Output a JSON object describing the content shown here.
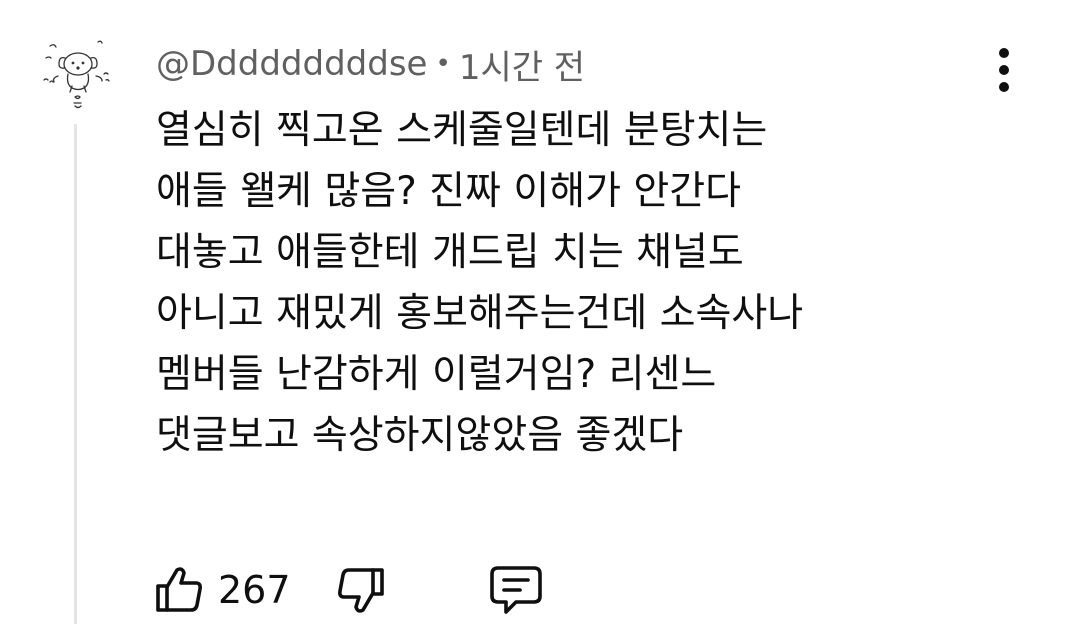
{
  "comment": {
    "author": "@Dddddddddse",
    "separator": "•",
    "time": "1시간 전",
    "lines": [
      "열심히 찍고온 스케줄일텐데 분탕치는",
      "애들 왤케 많음? 진짜 이해가 안간다",
      "대놓고 애들한테 개드립 치는 채널도",
      "아니고 재밌게 홍보해주는건데 소속사나",
      "멤버들 난감하게 이럴거임? 리센느",
      "댓글보고 속상하지않았음 좋겠다"
    ],
    "like_count": "267"
  },
  "icons": {
    "avatar": "puppy-doodle-avatar",
    "menu": "more-vertical-icon",
    "like": "thumbs-up-icon",
    "dislike": "thumbs-down-icon",
    "reply": "comment-icon"
  },
  "colors": {
    "text": "#0f0f0f",
    "meta": "#606060",
    "thread_line": "#e5e5e5"
  }
}
